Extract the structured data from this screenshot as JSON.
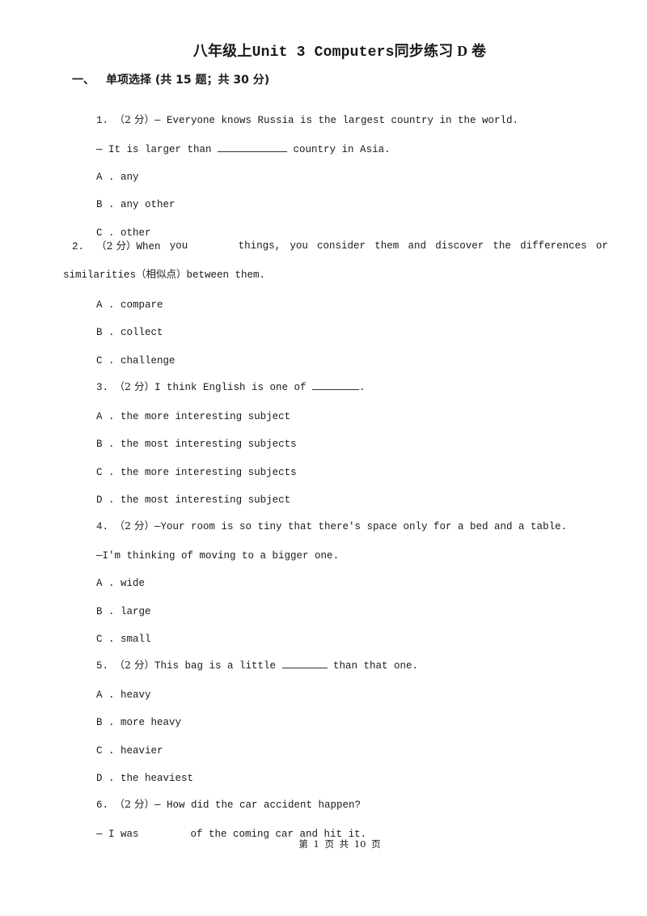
{
  "document": {
    "title_cn_prefix": "八年级上",
    "title_en": "Unit 3 Computers",
    "title_cn_suffix": "同步练习 D 卷",
    "section": {
      "number": "一、",
      "label": "单项选择 (共 15 题；共 30 分)"
    },
    "questions": [
      {
        "number": "1.",
        "score": "（2 分）",
        "lines": [
          "— Everyone knows Russia is the largest country in the world."
        ],
        "line2_before_blank": "— It is larger than ",
        "line2_after_blank": " country in Asia.",
        "options": [
          {
            "letter": "A .",
            "text": "any"
          },
          {
            "letter": "B .",
            "text": "any other"
          },
          {
            "letter": "C .",
            "text": "other"
          }
        ]
      },
      {
        "number": "2.",
        "score": "（2 分）",
        "line1_words": [
          "When",
          "you",
          "",
          "things,",
          "you",
          "consider",
          "them",
          "and",
          "discover",
          "the",
          "differences",
          "or"
        ],
        "line2": "similarities（相似点）between them.",
        "options": [
          {
            "letter": "A .",
            "text": "compare"
          },
          {
            "letter": "B .",
            "text": "collect"
          },
          {
            "letter": "C .",
            "text": "challenge"
          }
        ]
      },
      {
        "number": "3.",
        "score": "（2 分）",
        "text_before_blank": "I think English is one of ",
        "text_after_blank": ".",
        "options": [
          {
            "letter": "A .",
            "text": "the more interesting subject"
          },
          {
            "letter": "B .",
            "text": "the most interesting subjects"
          },
          {
            "letter": "C .",
            "text": "the more interesting subjects"
          },
          {
            "letter": "D .",
            "text": "the most interesting subject"
          }
        ]
      },
      {
        "number": "4.",
        "score": "（2 分）",
        "line1": "—Your room is so tiny that there's space only for a bed and a table.",
        "line2": "—I'm thinking of moving to a bigger one.",
        "options": [
          {
            "letter": "A .",
            "text": "wide"
          },
          {
            "letter": "B .",
            "text": "large"
          },
          {
            "letter": "C .",
            "text": "small"
          }
        ]
      },
      {
        "number": "5.",
        "score": "（2 分）",
        "text_before_blank": "This bag is a little ",
        "text_after_blank": " than that one.",
        "options": [
          {
            "letter": "A .",
            "text": "heavy"
          },
          {
            "letter": "B .",
            "text": "more heavy"
          },
          {
            "letter": "C .",
            "text": "heavier"
          },
          {
            "letter": "D .",
            "text": "the heaviest"
          }
        ]
      },
      {
        "number": "6.",
        "score": "（2 分）",
        "line1": "— How did the car accident happen?",
        "line2_before_gap": "— I was",
        "line2_after_gap": "of the coming car and hit it."
      }
    ],
    "footer": "第 1 页 共 10 页"
  }
}
